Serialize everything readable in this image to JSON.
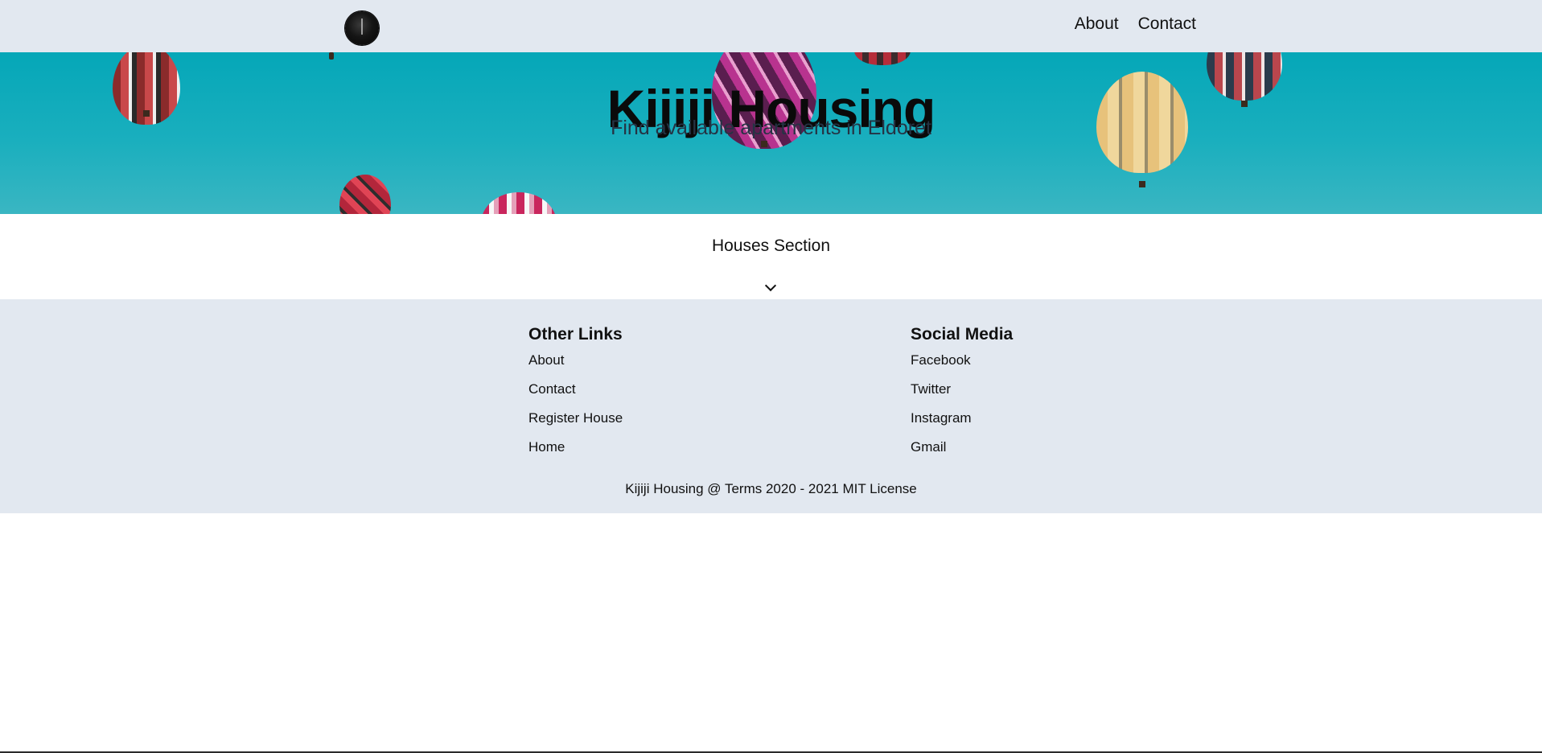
{
  "nav": {
    "links": [
      {
        "label": "About"
      },
      {
        "label": "Contact"
      }
    ]
  },
  "hero": {
    "title": "Kijiji Housing",
    "subtitle": "Find available apartments in Eldoret"
  },
  "houses": {
    "title": "Houses Section"
  },
  "footer": {
    "other_links": {
      "heading": "Other Links",
      "items": [
        "About",
        "Contact",
        "Register House",
        "Home"
      ]
    },
    "social_media": {
      "heading": "Social Media",
      "items": [
        "Facebook",
        "Twitter",
        "Instagram",
        "Gmail"
      ]
    },
    "copyright": "Kijiji Housing @ Terms 2020 - 2021 MIT License"
  },
  "colors": {
    "nav_bg": "#e2e8f0",
    "hero_sky": "#05a7b8",
    "footer_bg": "#e2e8f0"
  },
  "icons": {
    "logo": "logo-icon",
    "scroll": "chevron-down-icon"
  }
}
